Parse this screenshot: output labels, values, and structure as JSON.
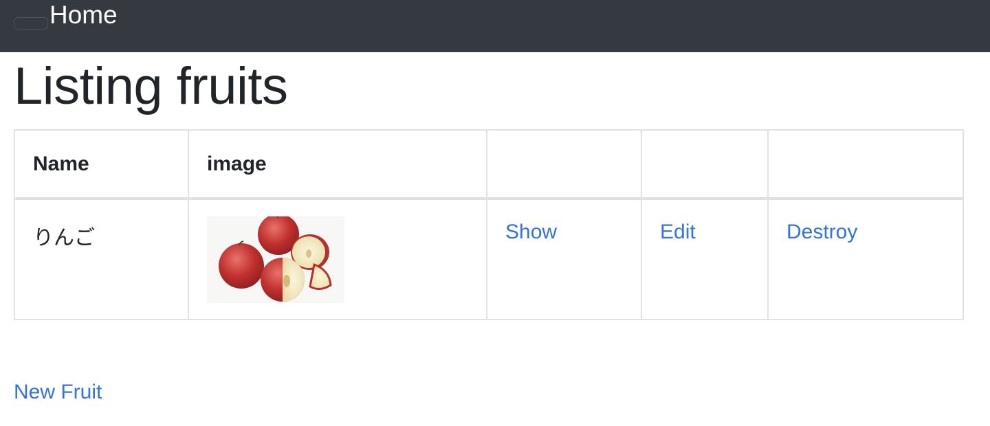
{
  "navbar": {
    "brand": "Home"
  },
  "page": {
    "title": "Listing fruits"
  },
  "table": {
    "headers": [
      "Name",
      "image",
      "",
      "",
      ""
    ],
    "rows": [
      {
        "name": "りんご",
        "image_icon": "apple-photo",
        "show_label": "Show",
        "edit_label": "Edit",
        "destroy_label": "Destroy"
      }
    ]
  },
  "actions": {
    "new_label": "New Fruit"
  },
  "colors": {
    "navbar_bg": "#343a40",
    "link": "#3274d9",
    "border": "#dee2e6"
  }
}
